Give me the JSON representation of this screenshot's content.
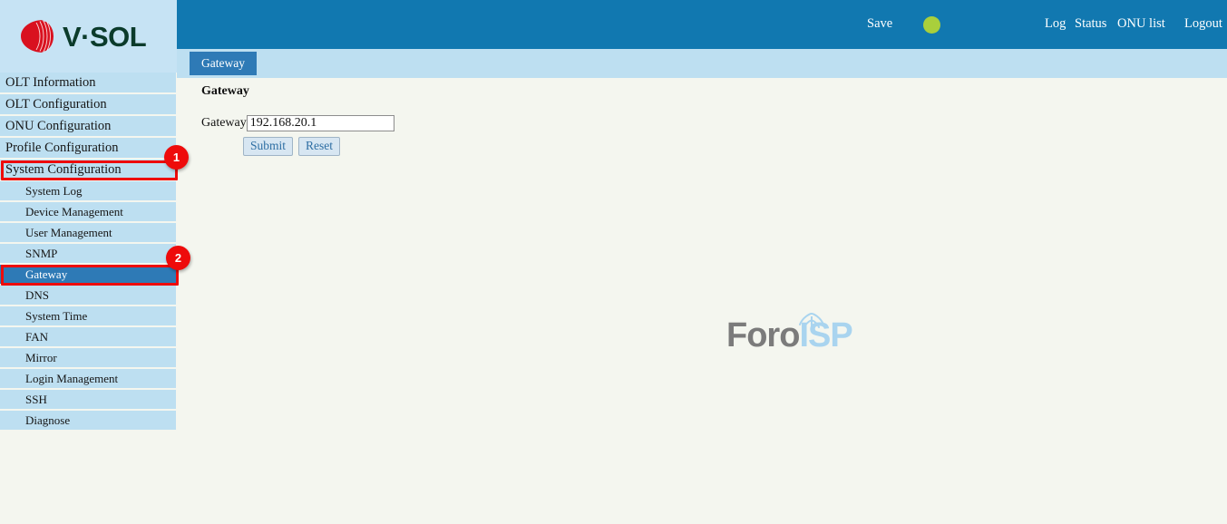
{
  "brand": {
    "logo_text": "V·SOL",
    "logo_mark_icon": "vsol-sphere-icon",
    "logo_red": "#d9111f",
    "logo_green": "#0b3b2b"
  },
  "header": {
    "bg_color": "#1178b0",
    "save_label": "Save",
    "status_dot_icon": "status-dot-icon",
    "status_dot_color": "#a9cf3c",
    "log_label": "Log",
    "status_label": "Status",
    "onu_list_label": "ONU list",
    "logout_label": "Logout"
  },
  "tabstrip": {
    "bg_color": "#bddff1",
    "tabs": [
      {
        "label": "Gateway",
        "active": true
      }
    ]
  },
  "sidebar": {
    "bg_color": "#bddff1",
    "selected_color": "#2e7ab6",
    "items": [
      {
        "label": "OLT Information",
        "level": "top",
        "selected": false
      },
      {
        "label": "OLT Configuration",
        "level": "top",
        "selected": false
      },
      {
        "label": "ONU Configuration",
        "level": "top",
        "selected": false
      },
      {
        "label": "Profile Configuration",
        "level": "top",
        "selected": false
      },
      {
        "label": "System Configuration",
        "level": "top",
        "selected": false
      },
      {
        "label": "System Log",
        "level": "sub",
        "selected": false
      },
      {
        "label": "Device Management",
        "level": "sub",
        "selected": false
      },
      {
        "label": "User Management",
        "level": "sub",
        "selected": false
      },
      {
        "label": "SNMP",
        "level": "sub",
        "selected": false
      },
      {
        "label": "Gateway",
        "level": "sub",
        "selected": true
      },
      {
        "label": "DNS",
        "level": "sub",
        "selected": false
      },
      {
        "label": "System Time",
        "level": "sub",
        "selected": false
      },
      {
        "label": "FAN",
        "level": "sub",
        "selected": false
      },
      {
        "label": "Mirror",
        "level": "sub",
        "selected": false
      },
      {
        "label": "Login Management",
        "level": "sub",
        "selected": false
      },
      {
        "label": "SSH",
        "level": "sub",
        "selected": false
      },
      {
        "label": "Diagnose",
        "level": "sub",
        "selected": false
      }
    ]
  },
  "main": {
    "panel_title": "Gateway",
    "gateway_field_label": "Gateway",
    "gateway_value": "192.168.20.1",
    "gateway_placeholder": "",
    "submit_label": "Submit",
    "reset_label": "Reset"
  },
  "watermark": {
    "text_primary": "Foro",
    "text_secondary": "ISP",
    "tower_icon": "antenna-tower-icon",
    "primary_color": "#7b7b7b",
    "secondary_color": "#a9d4ef"
  },
  "annotations": [
    {
      "badge": "1",
      "target": "System Configuration"
    },
    {
      "badge": "2",
      "target": "Gateway"
    }
  ]
}
